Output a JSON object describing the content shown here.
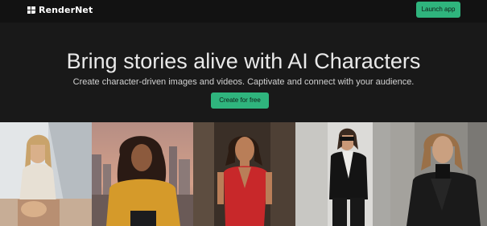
{
  "brand": {
    "name": "RenderNet",
    "logo_icon": "rendernet-logo-icon"
  },
  "nav": {
    "launch_label": "Launch app"
  },
  "hero": {
    "title": "Bring stories alive with AI Characters",
    "subtitle": "Create character-driven images and videos. Captivate and connect with your audience.",
    "cta_label": "Create for free"
  },
  "colors": {
    "accent": "#2fb47d",
    "background": "#191919",
    "topbar": "#121212"
  }
}
